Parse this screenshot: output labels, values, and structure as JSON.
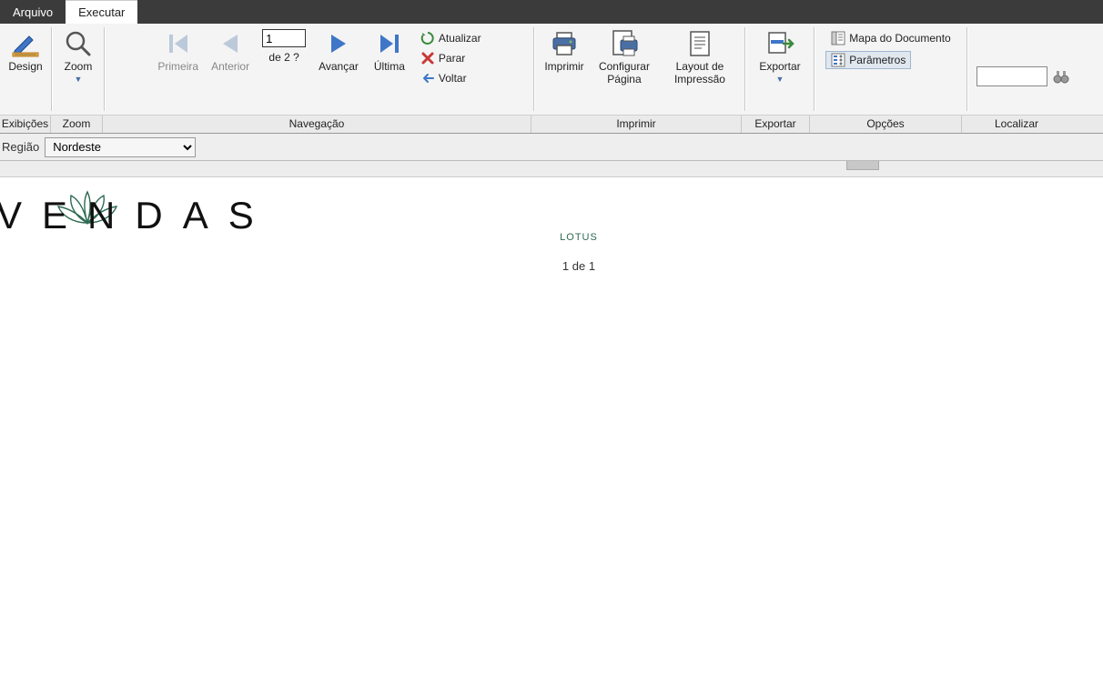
{
  "menu": {
    "arquivo": "Arquivo",
    "executar": "Executar"
  },
  "ribbon": {
    "design": "Design",
    "zoom": "Zoom",
    "primeira": "Primeira",
    "anterior": "Anterior",
    "page_value": "1",
    "page_of": "de  2 ?",
    "avancar": "Avançar",
    "ultima": "Última",
    "atualizar": "Atualizar",
    "parar": "Parar",
    "voltar": "Voltar",
    "imprimir_btn": "Imprimir",
    "configurar_pagina": "Configurar Página",
    "layout_impressao": "Layout de Impressão",
    "exportar_btn": "Exportar",
    "mapa_doc": "Mapa do Documento",
    "parametros": "Parâmetros",
    "group_exibicoes": "Exibições",
    "group_zoom": "Zoom",
    "group_navegacao": "Navegação",
    "group_imprimir": "Imprimir",
    "group_exportar": "Exportar",
    "group_opcoes": "Opções",
    "group_localizar": "Localizar"
  },
  "params": {
    "regiao_label": "Região",
    "regiao_value": "Nordeste"
  },
  "report": {
    "title": "VENDAS",
    "logo_text": "LOTUS",
    "page_indicator": "1 de 1"
  },
  "colors": {
    "nav_enabled": "#3f76c8",
    "nav_disabled": "#bcc9db",
    "accent_green": "#2d6b52"
  }
}
